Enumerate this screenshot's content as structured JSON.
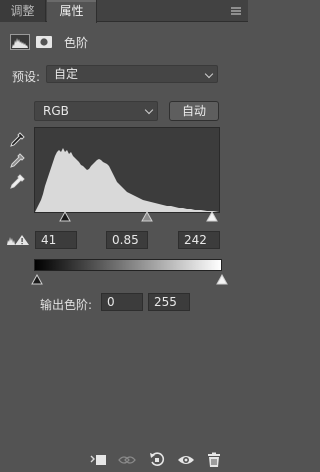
{
  "tabs": [
    {
      "label": "调整"
    },
    {
      "label": "属性"
    }
  ],
  "header": {
    "title": "色阶",
    "icons": [
      "levels-histogram-icon",
      "layer-mask-icon"
    ]
  },
  "preset": {
    "label": "预设:",
    "value": "自定"
  },
  "channel": {
    "value": "RGB"
  },
  "auto_button": {
    "label": "自动"
  },
  "tools": [
    "black-point-eyedropper-icon",
    "gray-point-eyedropper-icon",
    "white-point-eyedropper-icon"
  ],
  "input_levels": {
    "black": "41",
    "gamma": "0.85",
    "white": "242"
  },
  "output_levels": {
    "label": "输出色阶:",
    "black": "0",
    "white": "255"
  },
  "bottom_icons": [
    "clip-to-layer-icon",
    "view-previous-state-icon",
    "reset-icon",
    "visibility-eye-icon",
    "trash-icon"
  ],
  "colors": {
    "panel": "#535353",
    "tabbar": "#424242",
    "field": "#3c3c3c",
    "histogram": "#d9d9d9"
  }
}
